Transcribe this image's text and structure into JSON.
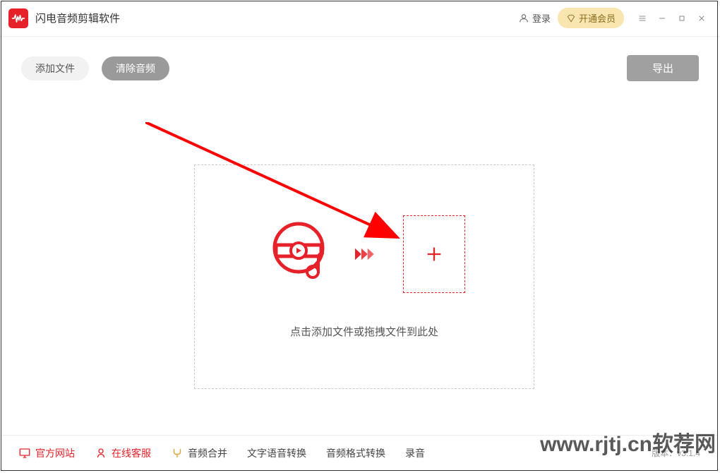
{
  "app": {
    "title": "闪电音频剪辑软件"
  },
  "titlebar": {
    "login": "登录",
    "vip": "开通会员"
  },
  "toolbar": {
    "add_file": "添加文件",
    "clear_audio": "清除音频",
    "export": "导出"
  },
  "drop": {
    "hint": "点击添加文件或拖拽文件到此处"
  },
  "bottom": {
    "official_site": "官方网站",
    "online_service": "在线客服",
    "audio_merge": "音频合并",
    "tts": "文字语音转换",
    "format_convert": "音频格式转换",
    "record": "录音",
    "version": "版本：v3.1.4"
  },
  "watermark": "www.rjtj.cn软荐网"
}
